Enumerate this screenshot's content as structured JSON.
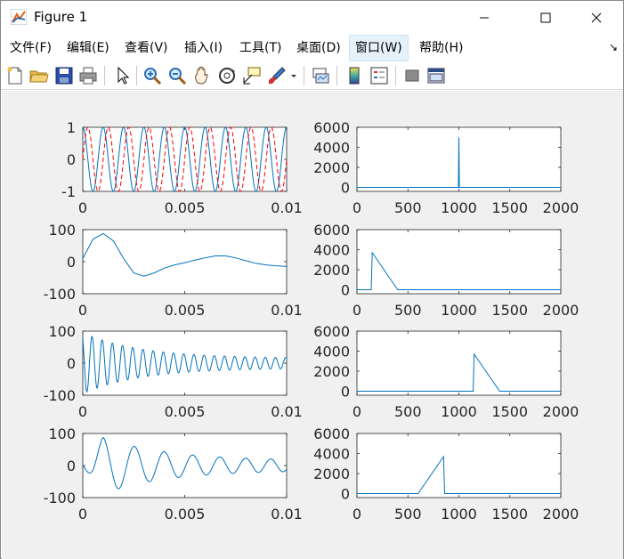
{
  "window": {
    "title": "Figure 1",
    "minimize_icon": "minimize-icon",
    "maximize_icon": "maximize-icon",
    "close_icon": "close-icon"
  },
  "menu": [
    {
      "label": "文件(F)"
    },
    {
      "label": "编辑(E)"
    },
    {
      "label": "查看(V)"
    },
    {
      "label": "插入(I)"
    },
    {
      "label": "工具(T)"
    },
    {
      "label": "桌面(D)"
    },
    {
      "label": "窗口(W)"
    },
    {
      "label": "帮助(H)"
    }
  ],
  "toolbar": [
    "new-figure-icon",
    "open-file-icon",
    "save-icon",
    "print-icon",
    "pointer-icon",
    "zoom-in-icon",
    "zoom-out-icon",
    "pan-icon",
    "rotate-3d-icon",
    "data-cursor-icon",
    "brush-icon",
    "link-plot-icon",
    "colorbar-icon",
    "legend-icon",
    "hide-plot-tools-icon",
    "show-plot-tools-icon"
  ],
  "colors": {
    "series_blue": "#0072bd",
    "series_red_dashed": "#ff0000",
    "canvas_bg": "#f0f0f0",
    "axes_bg": "#ffffff"
  },
  "chart_data": [
    {
      "type": "line",
      "subplot": "4x2 position 1",
      "x_range": [
        0,
        0.01
      ],
      "ylim": [
        -1,
        1
      ],
      "xticks": [
        "0",
        "0.005",
        "0.01"
      ],
      "yticks": [
        "-1",
        "0",
        "1"
      ],
      "series": [
        {
          "style": "solid blue",
          "function": "cos",
          "frequency_hz": 1000,
          "amplitude": 1
        },
        {
          "style": "dashed red",
          "function": "sin",
          "frequency_hz": 1000,
          "amplitude": 1
        }
      ]
    },
    {
      "type": "line",
      "subplot": "4x2 position 2",
      "x_range": [
        0,
        2000
      ],
      "ylim": [
        -400,
        6000
      ],
      "xticks": [
        "0",
        "500",
        "1000",
        "1500",
        "2000"
      ],
      "yticks": [
        "0",
        "2000",
        "4000",
        "6000"
      ],
      "points": [
        [
          0,
          0
        ],
        [
          995,
          0
        ],
        [
          1000,
          5000
        ],
        [
          1005,
          0
        ],
        [
          2000,
          0
        ]
      ]
    },
    {
      "type": "line",
      "subplot": "4x2 position 3",
      "x_range": [
        0,
        0.01
      ],
      "ylim": [
        -100,
        100
      ],
      "xticks": [
        "0",
        "0.005",
        "0.01"
      ],
      "yticks": [
        "-100",
        "0",
        "100"
      ],
      "points": [
        [
          0,
          10
        ],
        [
          0.0005,
          70
        ],
        [
          0.001,
          88
        ],
        [
          0.0015,
          65
        ],
        [
          0.002,
          10
        ],
        [
          0.0025,
          -35
        ],
        [
          0.003,
          -45
        ],
        [
          0.0035,
          -35
        ],
        [
          0.004,
          -20
        ],
        [
          0.0045,
          -10
        ],
        [
          0.005,
          -3
        ],
        [
          0.0055,
          5
        ],
        [
          0.006,
          12
        ],
        [
          0.0065,
          18
        ],
        [
          0.007,
          18
        ],
        [
          0.0075,
          12
        ],
        [
          0.008,
          3
        ],
        [
          0.0085,
          -5
        ],
        [
          0.009,
          -10
        ],
        [
          0.0095,
          -13
        ],
        [
          0.01,
          -15
        ]
      ]
    },
    {
      "type": "line",
      "subplot": "4x2 position 4",
      "x_range": [
        0,
        2000
      ],
      "ylim": [
        -400,
        6000
      ],
      "xticks": [
        "0",
        "500",
        "1000",
        "1500",
        "2000"
      ],
      "yticks": [
        "0",
        "2000",
        "4000",
        "6000"
      ],
      "points": [
        [
          0,
          0
        ],
        [
          140,
          0
        ],
        [
          150,
          3700
        ],
        [
          400,
          0
        ],
        [
          2000,
          0
        ]
      ]
    },
    {
      "type": "line",
      "subplot": "4x2 position 5",
      "x_range": [
        0,
        0.01
      ],
      "ylim": [
        -100,
        100
      ],
      "xticks": [
        "0",
        "0.005",
        "0.01"
      ],
      "yticks": [
        "-100",
        "0",
        "100"
      ],
      "signal": {
        "kind": "decaying oscillation",
        "start_amplitude": 95,
        "end_amplitude": 15,
        "periods_in_window": 20
      }
    },
    {
      "type": "line",
      "subplot": "4x2 position 6",
      "x_range": [
        0,
        2000
      ],
      "ylim": [
        -400,
        6000
      ],
      "xticks": [
        "0",
        "500",
        "1000",
        "1500",
        "2000"
      ],
      "yticks": [
        "0",
        "2000",
        "4000",
        "6000"
      ],
      "points": [
        [
          0,
          0
        ],
        [
          1140,
          0
        ],
        [
          1150,
          3700
        ],
        [
          1400,
          0
        ],
        [
          2000,
          0
        ]
      ]
    },
    {
      "type": "line",
      "subplot": "4x2 position 7",
      "x_range": [
        0,
        0.01
      ],
      "ylim": [
        -100,
        100
      ],
      "xticks": [
        "0",
        "0.005",
        "0.01"
      ],
      "yticks": [
        "-100",
        "0",
        "100"
      ],
      "signal": {
        "kind": "chirp with decay",
        "peak_amplitude": 88,
        "end_amplitude": 15,
        "frequency_range_hz": [
          600,
          850
        ]
      }
    },
    {
      "type": "line",
      "subplot": "4x2 position 8",
      "x_range": [
        0,
        2000
      ],
      "ylim": [
        -400,
        6000
      ],
      "xticks": [
        "0",
        "500",
        "1000",
        "1500",
        "2000"
      ],
      "yticks": [
        "0",
        "2000",
        "4000",
        "6000"
      ],
      "points": [
        [
          0,
          0
        ],
        [
          600,
          0
        ],
        [
          850,
          3700
        ],
        [
          860,
          0
        ],
        [
          2000,
          0
        ]
      ]
    }
  ]
}
